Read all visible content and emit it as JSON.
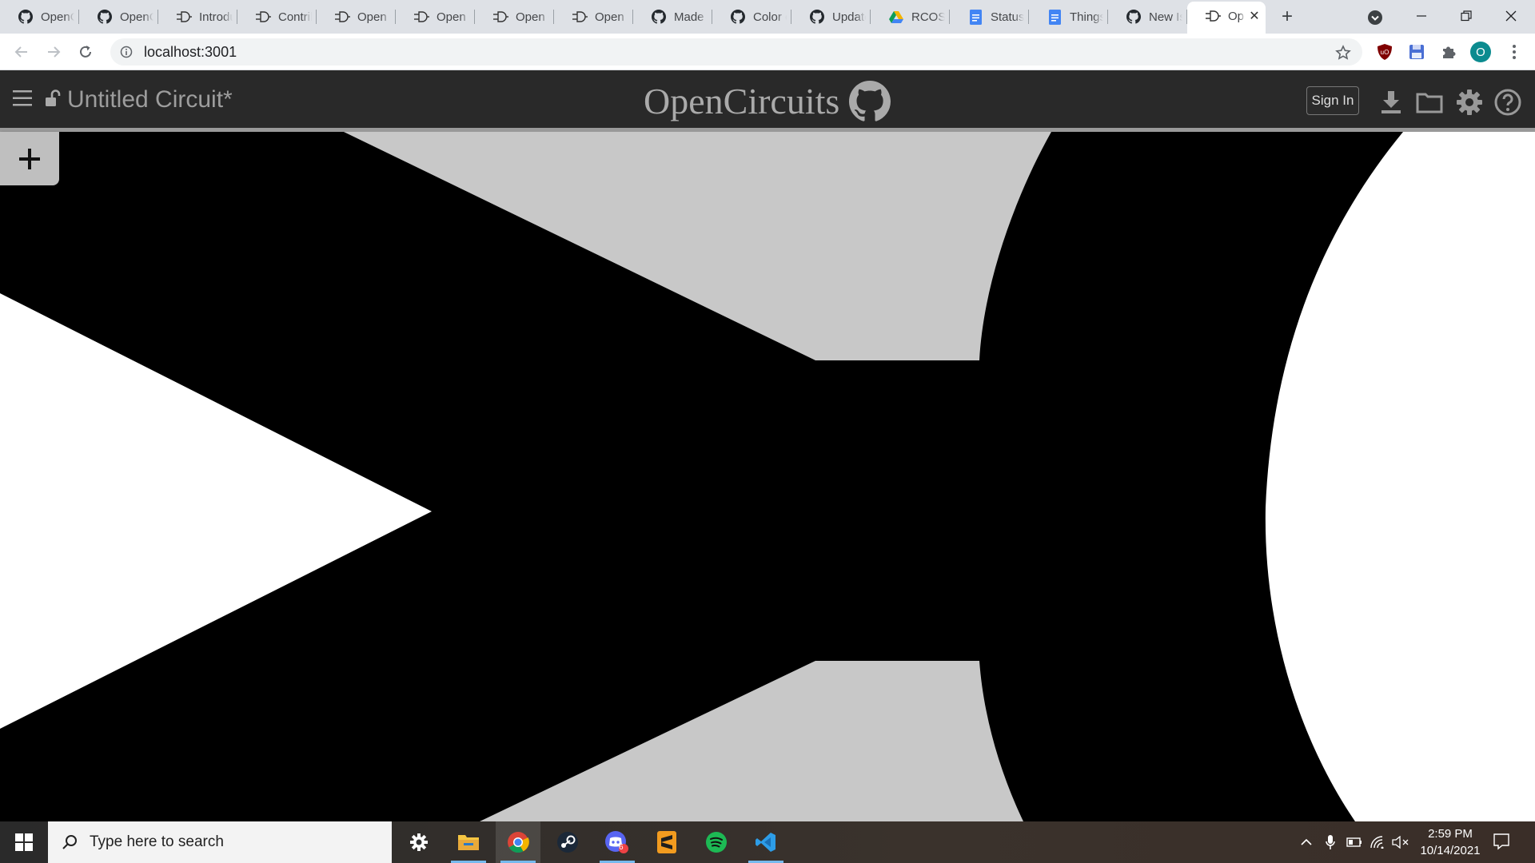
{
  "browser": {
    "tabs": [
      {
        "title": "OpenCircuits",
        "icon": "github-icon"
      },
      {
        "title": "OpenCircuits",
        "icon": "github-icon"
      },
      {
        "title": "Introduction",
        "icon": "opencircuits-icon"
      },
      {
        "title": "Contributing",
        "icon": "opencircuits-icon"
      },
      {
        "title": "Open Circuits",
        "icon": "opencircuits-icon"
      },
      {
        "title": "Open Circuits",
        "icon": "opencircuits-icon"
      },
      {
        "title": "Open Circuits",
        "icon": "opencircuits-icon"
      },
      {
        "title": "Open Circuits",
        "icon": "opencircuits-icon"
      },
      {
        "title": "Made by",
        "icon": "github-icon"
      },
      {
        "title": "Color of",
        "icon": "github-icon"
      },
      {
        "title": "Update",
        "icon": "github-icon"
      },
      {
        "title": "RCOS -",
        "icon": "google-drive-icon"
      },
      {
        "title": "Status U",
        "icon": "google-docs-icon"
      },
      {
        "title": "Things",
        "icon": "google-docs-icon"
      },
      {
        "title": "New Issue",
        "icon": "github-icon"
      },
      {
        "title": "OpenCircuits",
        "icon": "opencircuits-icon",
        "active": true
      }
    ],
    "new_tab_label": "+",
    "url": "localhost:3001",
    "profile_initial": "O"
  },
  "app": {
    "circuit_name": "Untitled Circuit*",
    "brand": "OpenCircuits",
    "sign_in_label": "Sign In",
    "add_button_label": "+"
  },
  "taskbar": {
    "search_placeholder": "Type here to search",
    "time": "2:59 PM",
    "date": "10/14/2021",
    "discord_badge": "6"
  }
}
